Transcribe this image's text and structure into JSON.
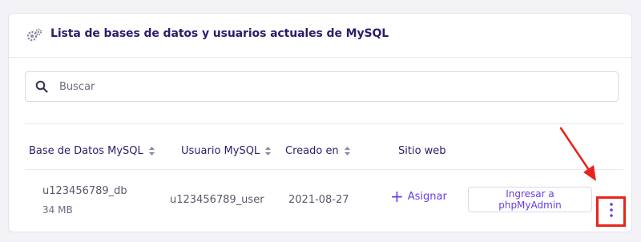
{
  "header": {
    "title": "Lista de bases de datos y usuarios actuales de MySQL",
    "icon": "gears-icon"
  },
  "search": {
    "placeholder": "Buscar",
    "value": "",
    "icon": "search-icon"
  },
  "table": {
    "columns": [
      {
        "label": "Base de Datos MySQL",
        "sortable": true
      },
      {
        "label": "Usuario MySQL",
        "sortable": true
      },
      {
        "label": "Creado en",
        "sortable": true
      },
      {
        "label": "Sitio web",
        "sortable": false
      }
    ],
    "rows": [
      {
        "database": "u123456789_db",
        "size": "34 MB",
        "user": "u123456789_user",
        "created": "2021-08-27",
        "website_action": "Asignar",
        "phpmyadmin_label": "Ingresar a phpMyAdmin",
        "more_icon": "kebab-menu-icon"
      }
    ]
  },
  "annotation": {
    "color": "#e8241c",
    "icon": "red-arrow"
  },
  "colors": {
    "accent": "#673de6",
    "heading": "#2f1c6a",
    "highlight": "#e8241c"
  }
}
